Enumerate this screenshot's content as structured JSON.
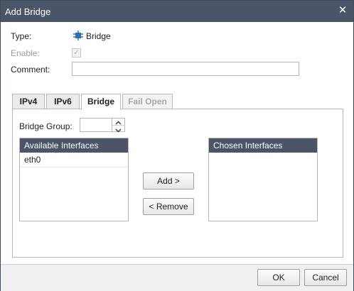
{
  "window": {
    "title": "Add Bridge",
    "close_symbol": "✕",
    "titlebar_color": "#4a5567"
  },
  "form": {
    "type_label": "Type:",
    "type_value": "Bridge",
    "type_icon": "bridge-icon",
    "enable_label": "Enable:",
    "enable_checked": true,
    "comment_label": "Comment:",
    "comment_value": ""
  },
  "tabs": [
    {
      "label": "IPv4",
      "active": false,
      "disabled": false
    },
    {
      "label": "IPv6",
      "active": false,
      "disabled": false
    },
    {
      "label": "Bridge",
      "active": true,
      "disabled": false
    },
    {
      "label": "Fail Open",
      "active": false,
      "disabled": true
    }
  ],
  "bridge_tab": {
    "bridge_group_label": "Bridge Group:",
    "bridge_group_value": "",
    "available": {
      "header": "Available Interfaces",
      "items": [
        "eth0"
      ]
    },
    "chosen": {
      "header": "Chosen Interfaces",
      "items": []
    },
    "add_button": "Add >",
    "remove_button": "< Remove"
  },
  "footer": {
    "ok": "OK",
    "cancel": "Cancel"
  }
}
